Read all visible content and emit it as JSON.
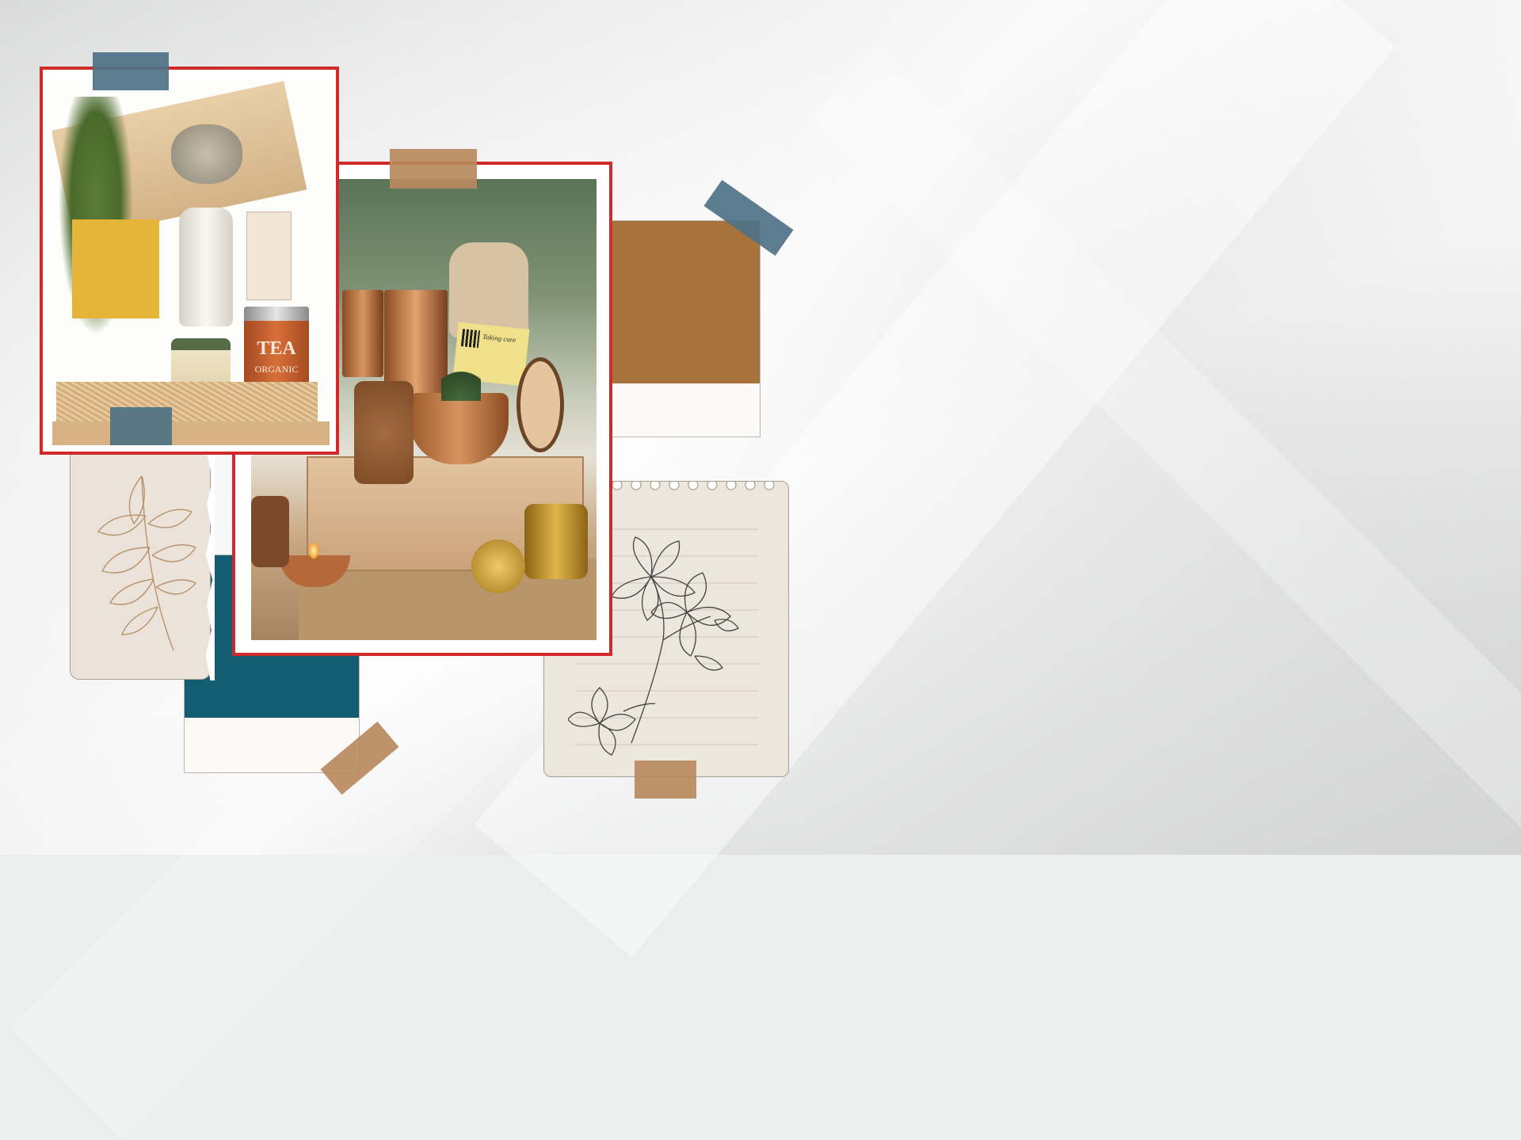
{
  "colors": {
    "frame_border": "#d12a2a",
    "tape_blue": "#4d7285",
    "tape_tan": "#b88a5e",
    "swatch_brown": "#a8723c",
    "swatch_teal": "#125e70",
    "note_paper": "#ece5dc",
    "sketch_line": "#b7926b"
  },
  "tea_tin": {
    "brand": "TEA",
    "sub": "ORGANIC"
  },
  "gift_card": {
    "text": "Taking care"
  },
  "icons": [
    "leaf-sketch",
    "flower-sketch"
  ]
}
